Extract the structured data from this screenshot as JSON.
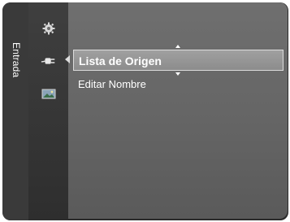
{
  "menu": {
    "title": "Entrada",
    "icons": [
      {
        "name": "settings",
        "label": ""
      },
      {
        "name": "input",
        "label": ""
      },
      {
        "name": "picture",
        "label": ""
      }
    ]
  },
  "submenu": {
    "items": [
      {
        "label": "Lista de Origen",
        "selected": true
      },
      {
        "label": "Editar Nombre",
        "selected": false
      }
    ]
  },
  "colors": {
    "frame": "#2b2b2b",
    "panel": "#666666",
    "selected_bar": "#979797",
    "text": "#ffffff"
  }
}
